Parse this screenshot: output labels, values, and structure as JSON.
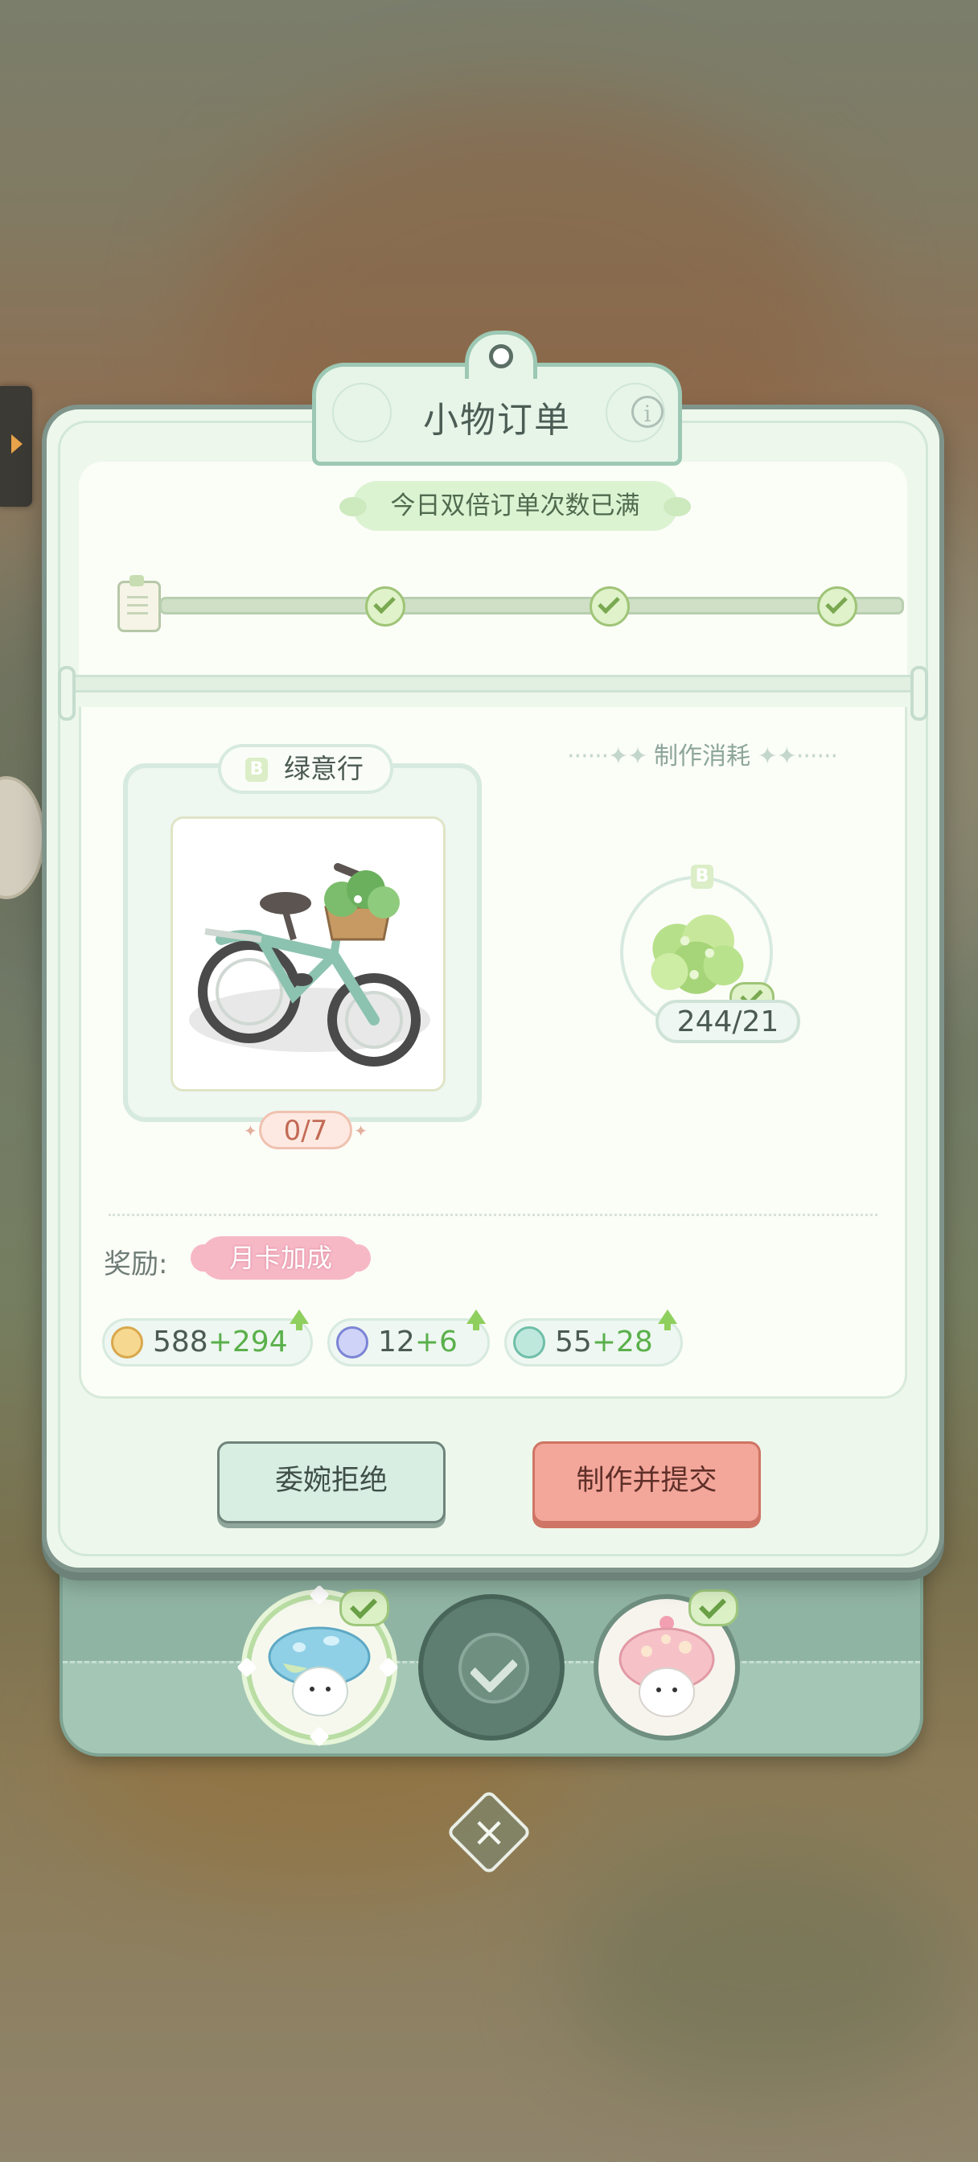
{
  "dialog": {
    "title": "小物订单",
    "info_icon": "i",
    "banner": "今日双倍订单次数已满",
    "progress_nodes": [
      "check",
      "check",
      "check"
    ]
  },
  "item": {
    "grade": "B",
    "name": "绿意行",
    "progress": "0/7",
    "image": "green-bicycle"
  },
  "cost": {
    "title": "制作消耗",
    "material": {
      "grade": "B",
      "image": "clover-bush",
      "count": "244/21"
    }
  },
  "rewards": {
    "label": "奖励:",
    "bonus_badge": "月卡加成",
    "items": [
      {
        "icon": "coin-icon",
        "base": "588",
        "bonus": "+294"
      },
      {
        "icon": "crystal-icon",
        "base": "12",
        "bonus": "+6"
      },
      {
        "icon": "exp-icon",
        "base": "55",
        "bonus": "+28"
      }
    ]
  },
  "buttons": {
    "refuse": "委婉拒绝",
    "submit": "制作并提交"
  },
  "colors": {
    "accent_green": "#9fc477",
    "submit_button": "#f3a69a",
    "bonus_text": "#5ab04b",
    "badge_pink": "#f7b8c6"
  }
}
